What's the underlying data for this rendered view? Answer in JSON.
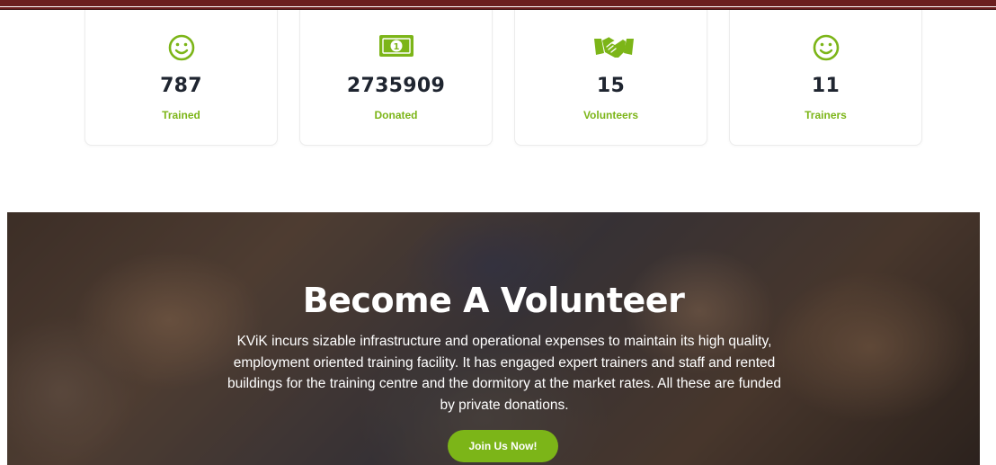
{
  "colors": {
    "accent": "#7cb518",
    "value_text": "#1f2530",
    "top_border": "#6b1f1f"
  },
  "stats": [
    {
      "icon": "smiley-icon",
      "value": "787",
      "label": "Trained"
    },
    {
      "icon": "money-icon",
      "value": "2735909",
      "label": "Donated"
    },
    {
      "icon": "handshake-icon",
      "value": "15",
      "label": "Volunteers"
    },
    {
      "icon": "smiley-icon",
      "value": "11",
      "label": "Trainers"
    }
  ],
  "volunteer": {
    "title": "Become A Volunteer",
    "description": "KViK incurs sizable infrastructure and operational expenses to maintain its high quality, employment oriented training facility. It has engaged expert trainers and staff and rented buildings for the training centre and the dormitory at the market rates. All these are funded by private donations.",
    "button_label": "Join Us Now!",
    "background_image": "children-photo"
  }
}
